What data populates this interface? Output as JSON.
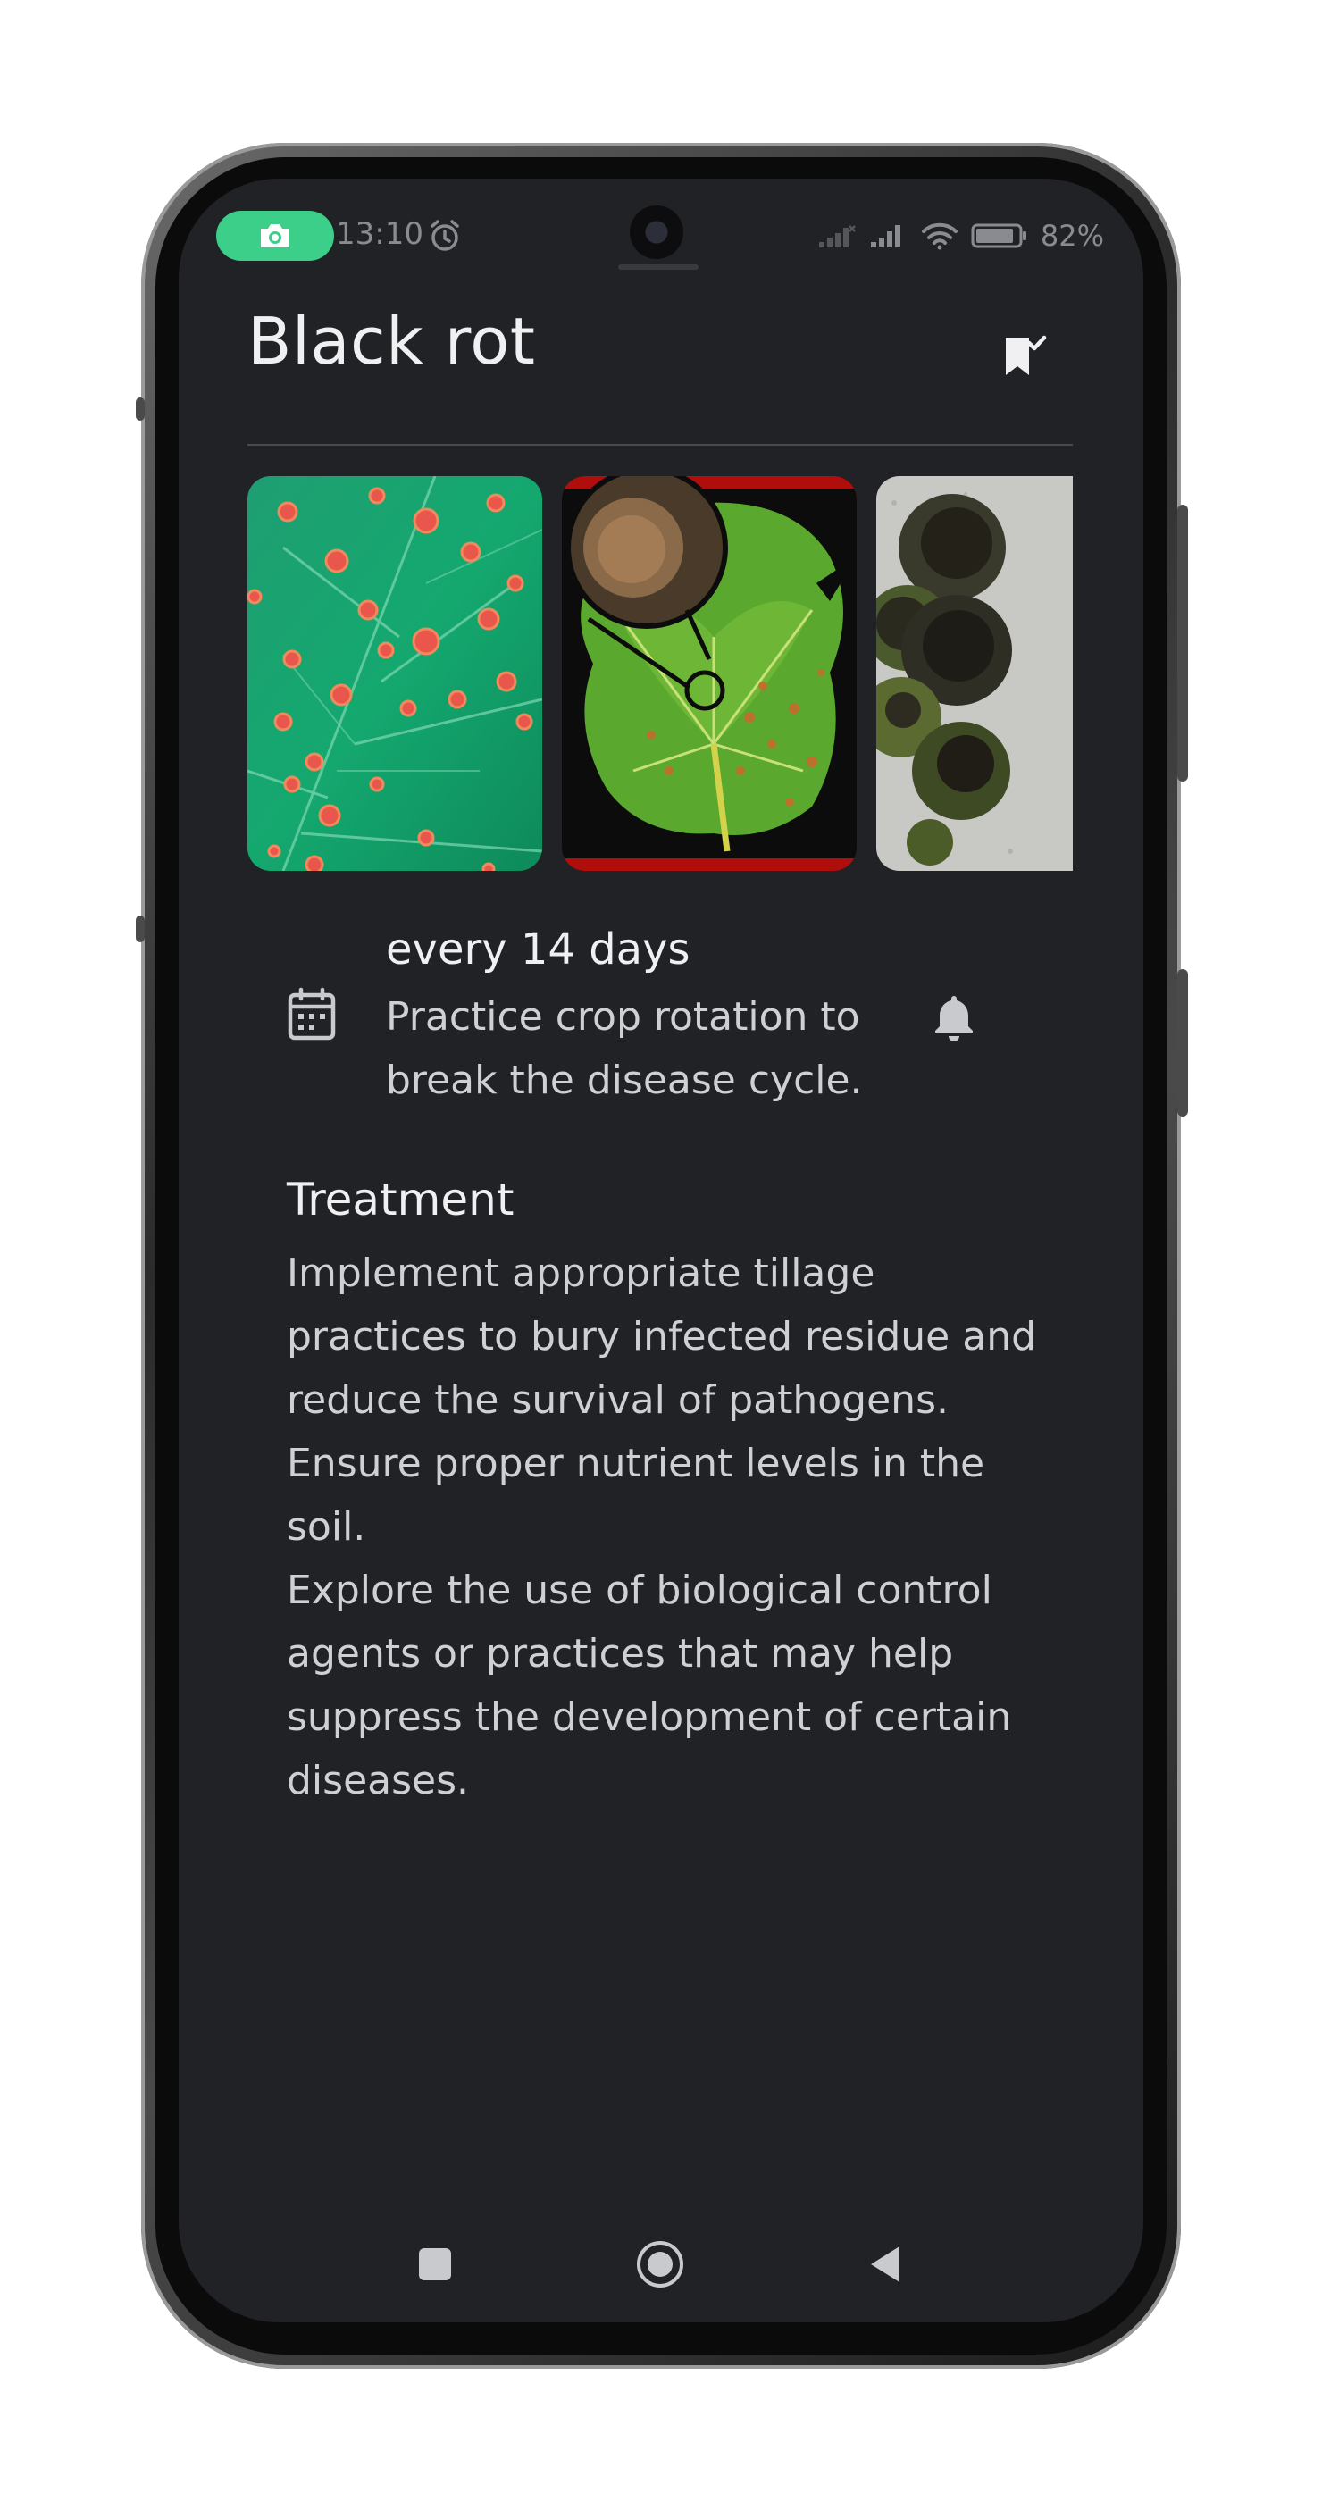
{
  "status_bar": {
    "time": "13:10",
    "battery": "82%"
  },
  "header": {
    "title": "Black rot"
  },
  "gallery": {
    "images": [
      {
        "name": "leaf-spots-image"
      },
      {
        "name": "leaf-lesion-magnified-image"
      },
      {
        "name": "black-rot-fruit-image"
      }
    ]
  },
  "schedule": {
    "frequency": "every 14 days",
    "tip": "Practice crop rotation to break the disease cycle."
  },
  "treatment": {
    "title": "Treatment",
    "paragraphs": [
      "Implement appropriate tillage practices to bury infected residue and reduce the survival of pathogens.",
      "Ensure proper nutrient levels in the soil.",
      "Explore the use of biological control agents or practices that may help suppress the development of certain diseases."
    ]
  },
  "colors": {
    "background": "#212226",
    "accent_green": "#3ccf8a",
    "text_primary": "#f0f0f2",
    "text_secondary": "#cfd0d3"
  }
}
